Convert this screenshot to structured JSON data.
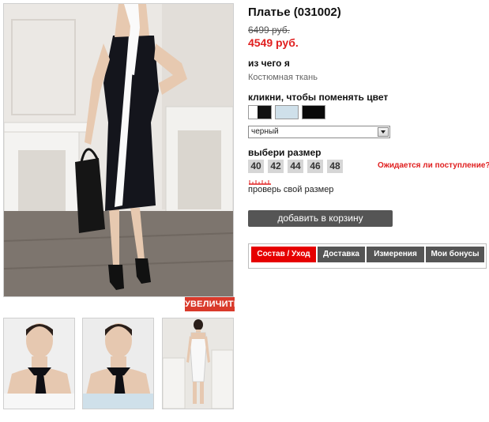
{
  "product": {
    "title": "Платье (031002)",
    "old_price": "6499 руб.",
    "new_price": "4549 руб.",
    "material_label": "из чего я",
    "material_value": "Костюмная ткань"
  },
  "gallery": {
    "zoom_label": "УВЕЛИЧИТЬ",
    "thumbnails": [
      "thumbnail-front-closeup-black",
      "thumbnail-front-closeup-white",
      "thumbnail-back-view"
    ]
  },
  "color": {
    "label": "кликни, чтобы поменять цвет",
    "swatches": [
      {
        "name": "black-white",
        "color": "#111111"
      },
      {
        "name": "light-blue",
        "color": "#cfe0ea"
      },
      {
        "name": "black",
        "color": "#0a0a0a"
      }
    ],
    "selected": "черный"
  },
  "size": {
    "label": "выбери размер",
    "options": [
      "40",
      "42",
      "44",
      "46",
      "48"
    ],
    "expect_link": "Ожидается ли поступление?",
    "check_link": "проверь свой размер"
  },
  "cart": {
    "button_label": "добавить в корзину"
  },
  "tabs": [
    {
      "label": "Состав / Уход",
      "active": true
    },
    {
      "label": "Доставка",
      "active": false
    },
    {
      "label": "Измерения",
      "active": false
    },
    {
      "label": "Мои бонусы",
      "active": false
    }
  ],
  "colors": {
    "accent_red": "#e60000",
    "dark_button": "#555555",
    "size_bg": "#d6d6d6"
  }
}
